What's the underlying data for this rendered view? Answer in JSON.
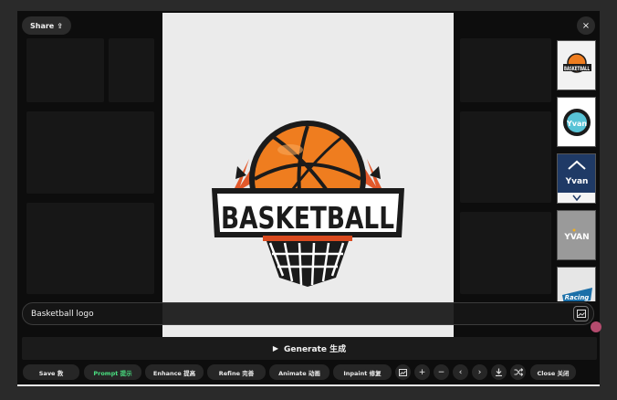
{
  "share": {
    "label": "Share",
    "icon": "share-icon"
  },
  "close": {
    "icon": "close-icon",
    "glyph": "×"
  },
  "main_image": {
    "alt": "BASKETBALL"
  },
  "thumbnails": [
    {
      "text": "BASKETBALL"
    },
    {
      "text": "Yvan"
    },
    {
      "text": "Yvan"
    },
    {
      "text": "YVAN"
    },
    {
      "text": "Racing"
    }
  ],
  "prompt": {
    "value": "Basketball logo"
  },
  "generate": {
    "label": "Generate 生成"
  },
  "toolbar": {
    "save": "Save 救",
    "prompt": "Prompt 提示",
    "enhance": "Enhance 提高",
    "refine": "Refine 完善",
    "animate": "Animate 动画",
    "inpaint": "Inpaint 修复",
    "close": "Close 关闭"
  },
  "colors": {
    "accent_green": "#4ade80",
    "panel": "#0d0d0d",
    "button": "#262626"
  }
}
